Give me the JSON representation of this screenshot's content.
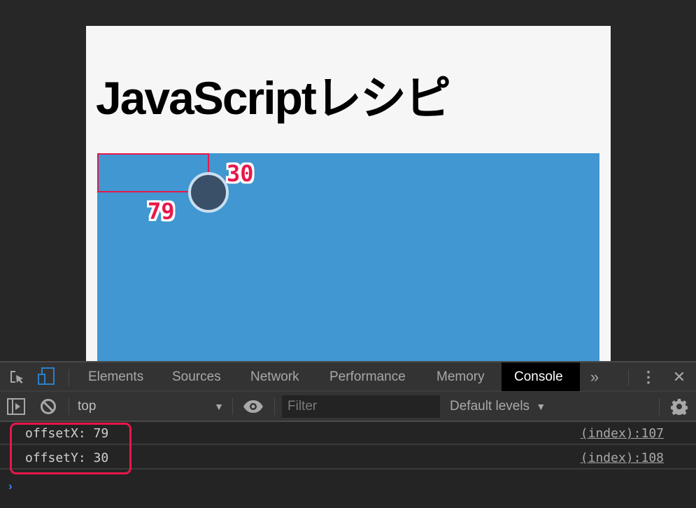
{
  "page": {
    "title": "JavaScriptレシピ",
    "annotation_y": "30",
    "annotation_x": "79",
    "colors": {
      "stage": "#4097d1",
      "accent": "#e8174a",
      "circle": "#3a5068"
    }
  },
  "devtools": {
    "tabs": [
      {
        "label": "Elements",
        "active": false
      },
      {
        "label": "Sources",
        "active": false
      },
      {
        "label": "Network",
        "active": false
      },
      {
        "label": "Performance",
        "active": false
      },
      {
        "label": "Memory",
        "active": false
      },
      {
        "label": "Console",
        "active": true
      }
    ],
    "icons": {
      "inspect": "inspect-element-icon",
      "device": "device-toolbar-icon",
      "more_tabs": "»",
      "kebab": "⋮",
      "close": "✕",
      "sidebar": "console-sidebar-icon",
      "clear": "clear-console-icon",
      "eye": "live-expression-icon",
      "settings": "gear-icon"
    },
    "toolbar": {
      "context": "top",
      "filter_placeholder": "Filter",
      "filter_value": "",
      "levels": "Default levels"
    },
    "console": {
      "messages": [
        {
          "text": "offsetX: 79",
          "source": "(index):107"
        },
        {
          "text": "offsetY: 30",
          "source": "(index):108"
        }
      ],
      "prompt": "›"
    }
  }
}
